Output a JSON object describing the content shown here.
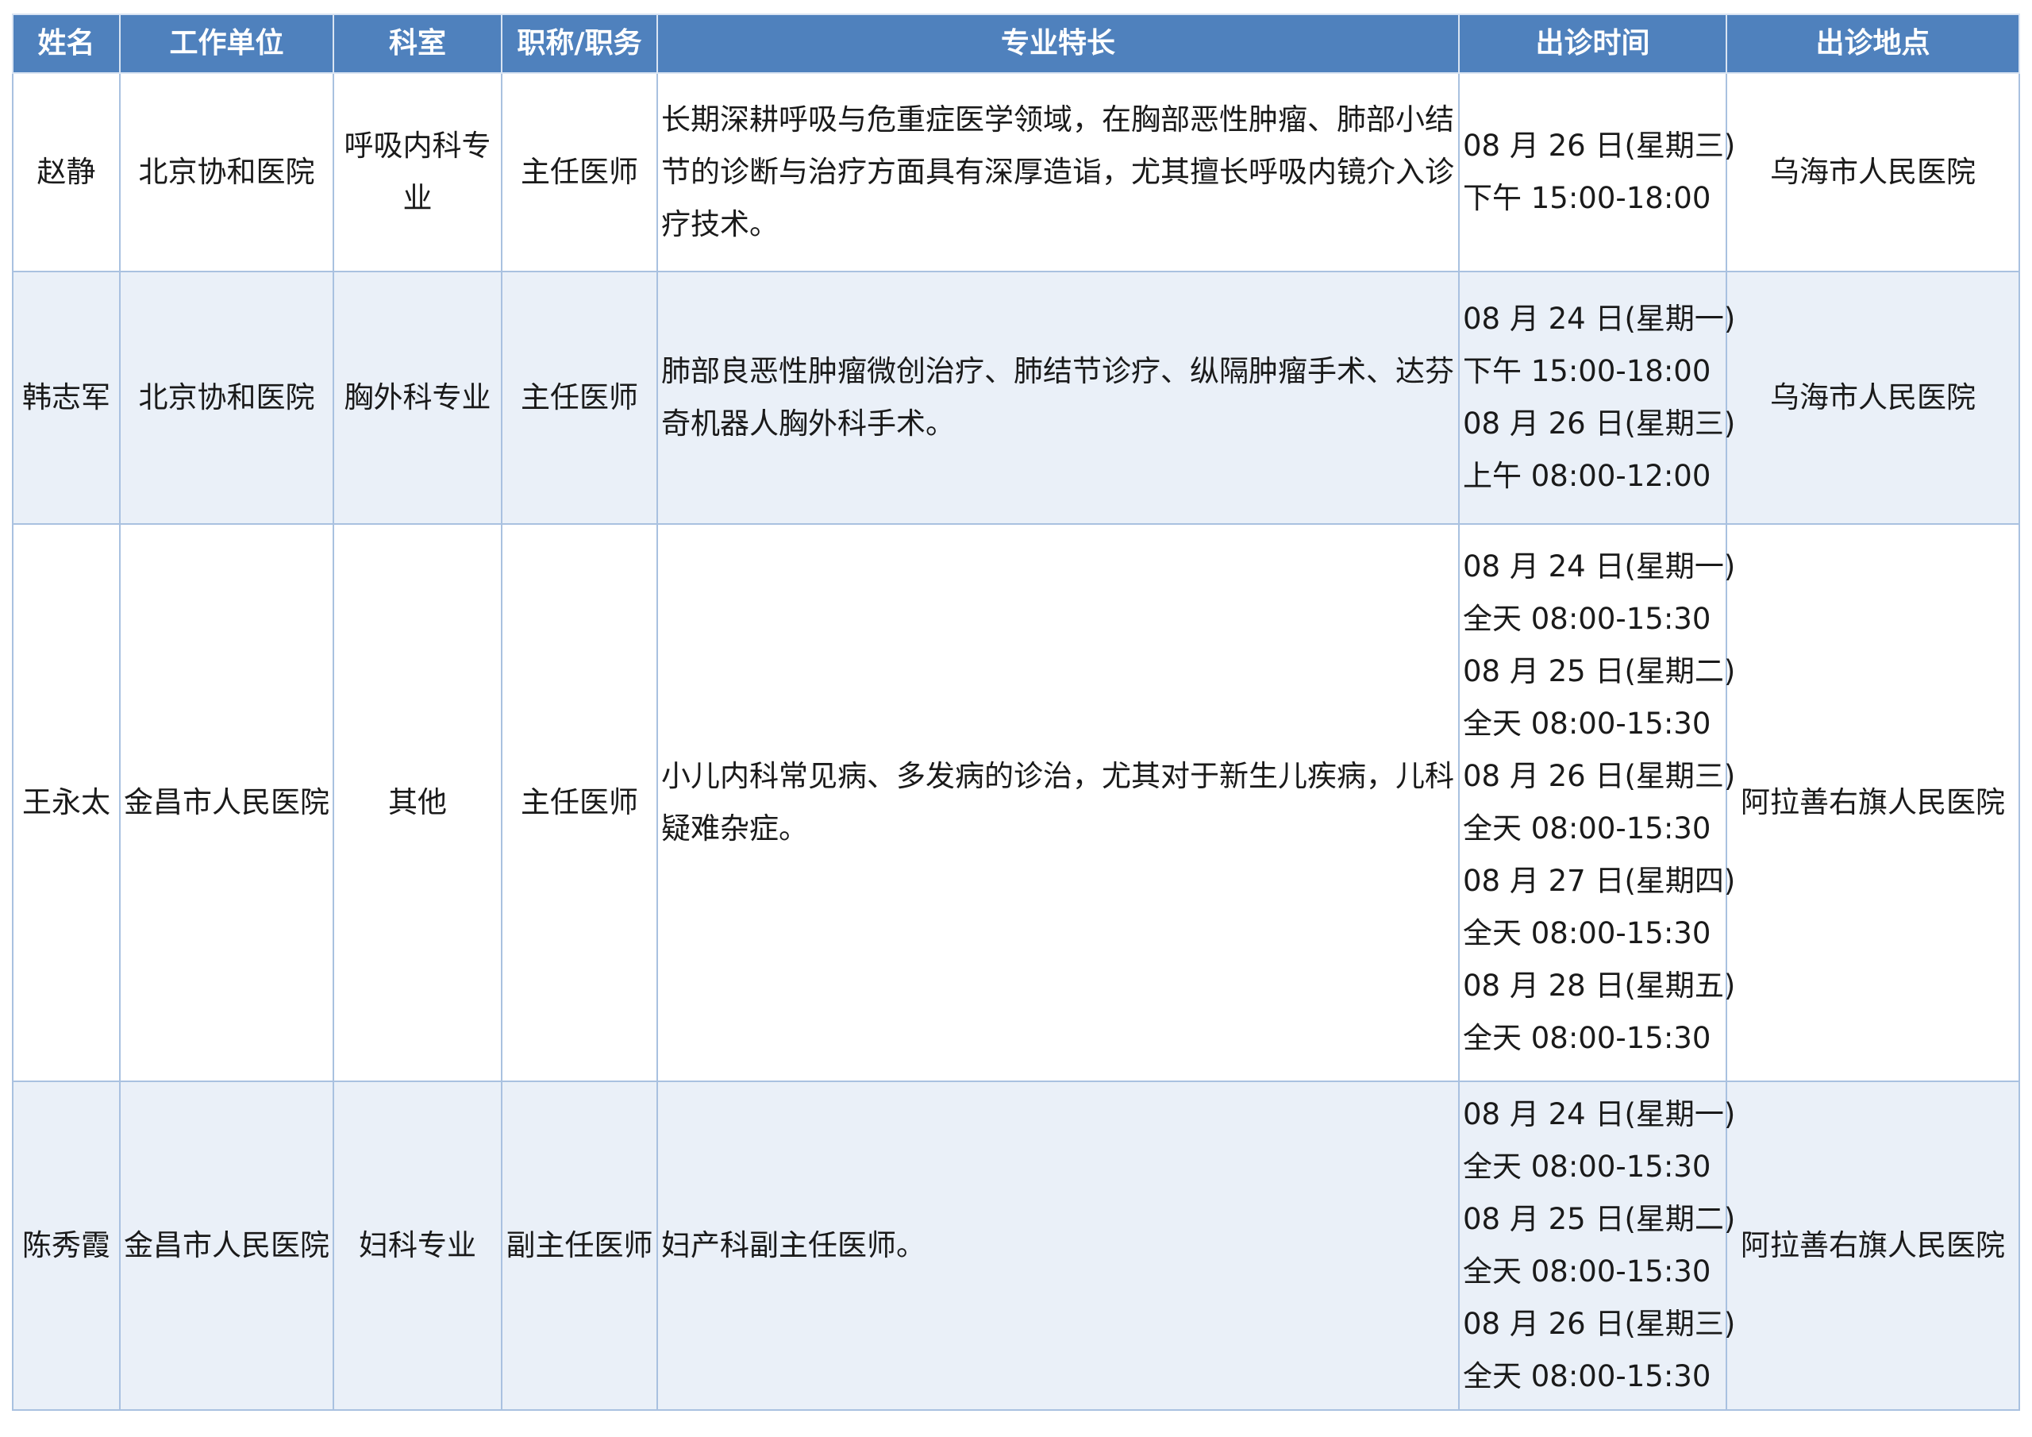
{
  "headers": {
    "name": "姓名",
    "unit": "工作单位",
    "dept": "科室",
    "title": "职称/职务",
    "specialty": "专业特长",
    "time": "出诊时间",
    "location": "出诊地点"
  },
  "rows": [
    {
      "name": "赵静",
      "unit": "北京协和医院",
      "dept_lines": [
        "呼吸内科专",
        "业"
      ],
      "title": "主任医师",
      "specialty_lines": [
        "长期深耕呼吸与危重症医学领域，在胸部恶性肿瘤、肺部小结",
        "节的诊断与治疗方面具有深厚造诣，尤其擅长呼吸内镜介入诊",
        "疗技术。"
      ],
      "time_lines": [
        "08 月 26 日(星期三)",
        "下午 15:00-18:00"
      ],
      "location": "乌海市人民医院"
    },
    {
      "name": "韩志军",
      "unit": "北京协和医院",
      "dept_lines": [
        "胸外科专业"
      ],
      "title": "主任医师",
      "specialty_lines": [
        "肺部良恶性肿瘤微创治疗、肺结节诊疗、纵隔肿瘤手术、达芬",
        "奇机器人胸外科手术。"
      ],
      "time_lines": [
        "08 月 24 日(星期一)",
        "下午 15:00-18:00",
        "08 月 26 日(星期三)",
        "上午 08:00-12:00"
      ],
      "location": "乌海市人民医院"
    },
    {
      "name": "王永太",
      "unit": "金昌市人民医院",
      "dept_lines": [
        "其他"
      ],
      "title": "主任医师",
      "specialty_lines": [
        "小儿内科常见病、多发病的诊治，尤其对于新生儿疾病，儿科",
        "疑难杂症。"
      ],
      "time_lines": [
        "08 月 24 日(星期一)",
        "全天 08:00-15:30",
        "08 月 25 日(星期二)",
        "全天 08:00-15:30",
        "08 月 26 日(星期三)",
        "全天 08:00-15:30",
        "08 月 27 日(星期四)",
        "全天 08:00-15:30",
        "08 月 28 日(星期五)",
        "全天 08:00-15:30"
      ],
      "location": "阿拉善右旗人民医院"
    },
    {
      "name": "陈秀霞",
      "unit": "金昌市人民医院",
      "dept_lines": [
        "妇科专业"
      ],
      "title": "副主任医师",
      "specialty_lines": [
        "妇产科副主任医师。"
      ],
      "time_lines": [
        "08 月 24 日(星期一)",
        "全天 08:00-15:30",
        "08 月 25 日(星期二)",
        "全天 08:00-15:30",
        "08 月 26 日(星期三)",
        "全天 08:00-15:30"
      ],
      "location": "阿拉善右旗人民医院"
    }
  ]
}
